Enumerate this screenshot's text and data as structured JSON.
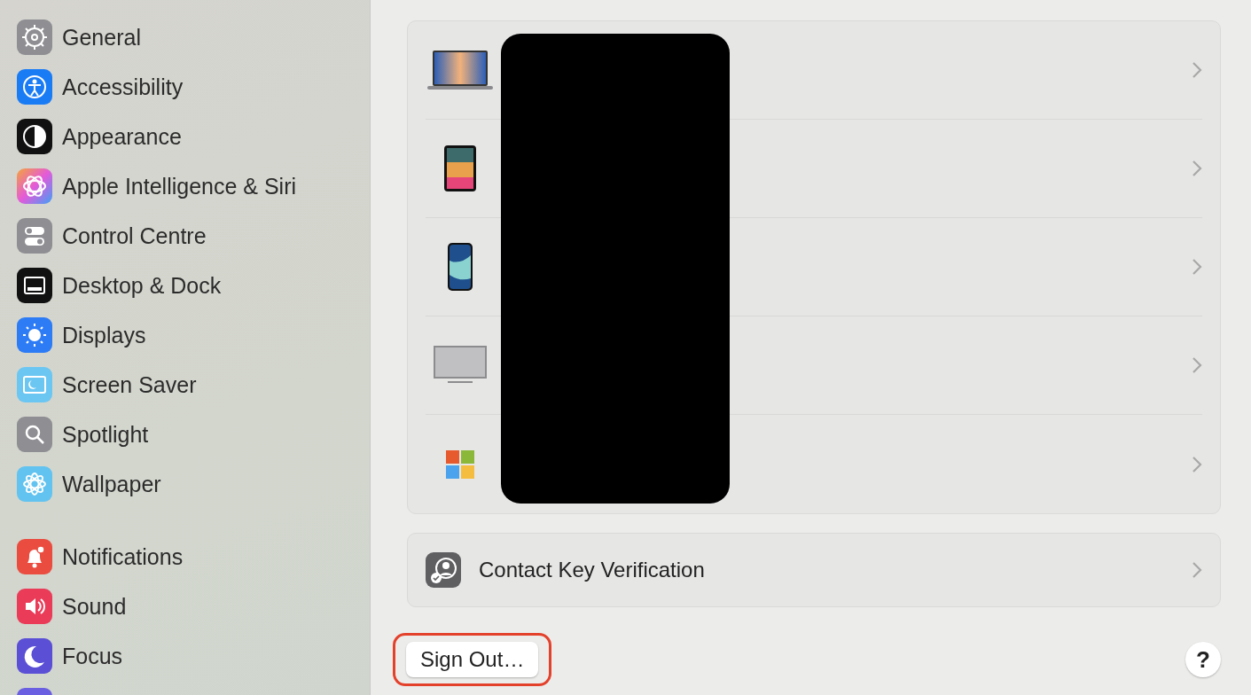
{
  "sidebar": {
    "sections": [
      {
        "items": [
          {
            "label": "General",
            "kind": "general"
          },
          {
            "label": "Accessibility",
            "kind": "accessibility"
          },
          {
            "label": "Appearance",
            "kind": "appearance"
          },
          {
            "label": "Apple Intelligence & Siri",
            "kind": "siri"
          },
          {
            "label": "Control Centre",
            "kind": "control"
          },
          {
            "label": "Desktop & Dock",
            "kind": "desktop"
          },
          {
            "label": "Displays",
            "kind": "displays"
          },
          {
            "label": "Screen Saver",
            "kind": "screensaver"
          },
          {
            "label": "Spotlight",
            "kind": "spotlight"
          },
          {
            "label": "Wallpaper",
            "kind": "wallpaper"
          }
        ]
      },
      {
        "items": [
          {
            "label": "Notifications",
            "kind": "notifications"
          },
          {
            "label": "Sound",
            "kind": "sound"
          },
          {
            "label": "Focus",
            "kind": "focus"
          },
          {
            "kind": "partial"
          }
        ]
      }
    ]
  },
  "devices": [
    {
      "kind": "laptop"
    },
    {
      "kind": "tablet"
    },
    {
      "kind": "phone"
    },
    {
      "kind": "monitor"
    },
    {
      "kind": "windows"
    }
  ],
  "redacted": true,
  "contact_key": {
    "label": "Contact Key Verification"
  },
  "sign_out": {
    "label": "Sign Out…",
    "highlighted": true
  },
  "help": {
    "label": "?"
  }
}
